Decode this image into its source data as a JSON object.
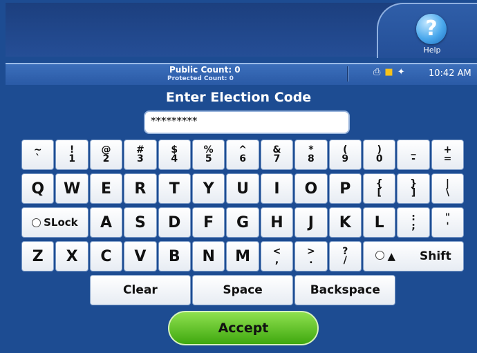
{
  "header": {
    "help_label": "Help",
    "help_glyph": "?"
  },
  "status": {
    "public_count": "Public Count: 0",
    "protected_count": "Protected Count: 0",
    "time": "10:42 AM",
    "icons": [
      "printer-icon",
      "save-icon",
      "power-plug-icon"
    ]
  },
  "screen": {
    "title": "Enter Election Code",
    "code_value": "*********"
  },
  "keyboard": {
    "row1": [
      {
        "top": "~",
        "bottom": "`"
      },
      {
        "top": "!",
        "bottom": "1"
      },
      {
        "top": "@",
        "bottom": "2"
      },
      {
        "top": "#",
        "bottom": "3"
      },
      {
        "top": "$",
        "bottom": "4"
      },
      {
        "top": "%",
        "bottom": "5"
      },
      {
        "top": "^",
        "bottom": "6"
      },
      {
        "top": "&",
        "bottom": "7"
      },
      {
        "top": "*",
        "bottom": "8"
      },
      {
        "top": "(",
        "bottom": "9"
      },
      {
        "top": ")",
        "bottom": "0"
      },
      {
        "top": "_",
        "bottom": "-"
      },
      {
        "top": "+",
        "bottom": "="
      }
    ],
    "row2": [
      "Q",
      "W",
      "E",
      "R",
      "T",
      "Y",
      "U",
      "I",
      "O",
      "P"
    ],
    "row2_brackets": [
      {
        "top": "{",
        "bottom": "["
      },
      {
        "top": "}",
        "bottom": "]"
      },
      {
        "top": "|",
        "bottom": "\\"
      }
    ],
    "slock_label": "SLock",
    "row3": [
      "A",
      "S",
      "D",
      "F",
      "G",
      "H",
      "J",
      "K",
      "L"
    ],
    "row3_punct": [
      {
        "top": ":",
        "bottom": ";"
      },
      {
        "top": "\"",
        "bottom": "'"
      }
    ],
    "row4": [
      "Z",
      "X",
      "C",
      "V",
      "B",
      "N",
      "M"
    ],
    "row4_punct": [
      {
        "top": "<",
        "bottom": ","
      },
      {
        "top": ">",
        "bottom": "."
      },
      {
        "top": "?",
        "bottom": "/"
      }
    ],
    "shift_label": "Shift",
    "shift_arrow": "▲",
    "clear_label": "Clear",
    "space_label": "Space",
    "backspace_label": "Backspace"
  },
  "actions": {
    "accept_label": "Accept"
  },
  "colors": {
    "background": "#1d4c92",
    "accept": "#52b81c"
  }
}
